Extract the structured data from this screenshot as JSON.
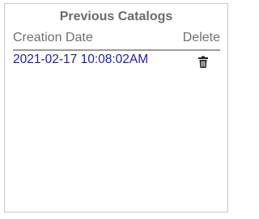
{
  "catalogs_panel": {
    "title": "Previous Catalogs",
    "columns": {
      "creation_date": "Creation Date",
      "delete": "Delete"
    },
    "rows": [
      {
        "creation_date": "2021-02-17 10:08:02AM",
        "delete_icon": "trash-icon"
      }
    ]
  },
  "colors": {
    "title": "#6b6b6b",
    "header_text": "#707070",
    "row_text": "#1f1f9a",
    "border": "#c8c8c8",
    "header_rule": "#9a9a9a"
  }
}
